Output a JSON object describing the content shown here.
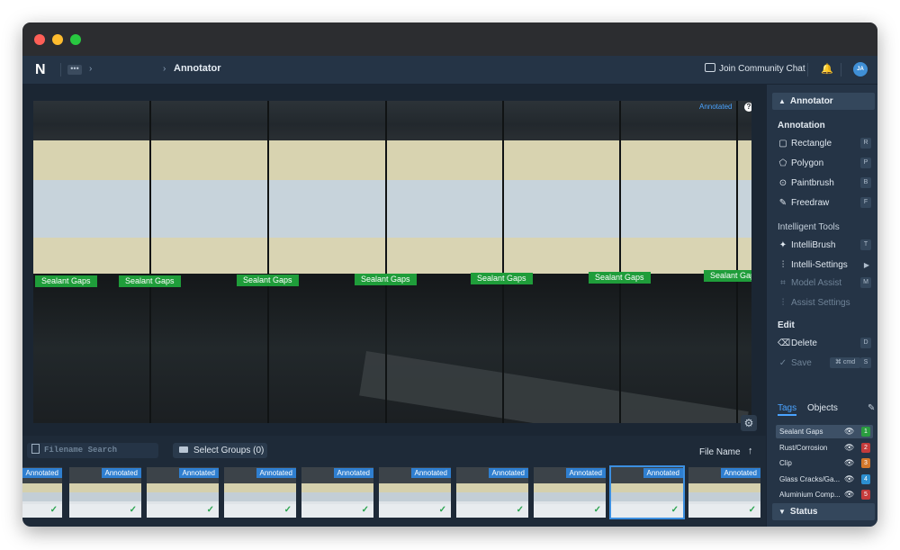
{
  "app": {
    "logo_letter": "N",
    "breadcrumb_ellipsis": "•••",
    "breadcrumb_sep": "›",
    "page_title": "Annotator",
    "community_label": "Join Community Chat",
    "avatar_initials": "JA"
  },
  "canvas": {
    "annotated_badge": "Annotated",
    "help_glyph": "?",
    "labels": [
      "Sealant Gaps",
      "Sealant Gaps",
      "Sealant Gaps",
      "Sealant Gaps",
      "Sealant Gaps",
      "Sealant Gaps",
      "Sealant Gap"
    ]
  },
  "filebar": {
    "search_placeholder": "Filename Search",
    "select_groups": "Select Groups (0)",
    "sort_label": "File Name",
    "sort_arrow": "↑"
  },
  "thumbnails": {
    "badge": "Annotated",
    "check": "✓",
    "count": 10,
    "selected_index": 8
  },
  "sidebar": {
    "panel_title": "Annotator",
    "annotation_title": "Annotation",
    "tools": [
      {
        "label": "Rectangle",
        "key": "R",
        "icon": "rectangle-icon"
      },
      {
        "label": "Polygon",
        "key": "P",
        "icon": "polygon-icon"
      },
      {
        "label": "Paintbrush",
        "key": "B",
        "icon": "paintbrush-icon"
      },
      {
        "label": "Freedraw",
        "key": "F",
        "icon": "pencil-icon"
      }
    ],
    "intelligent_title": "Intelligent Tools",
    "intelli": [
      {
        "label": "IntelliBrush",
        "key": "T"
      },
      {
        "label": "Intelli-Settings"
      },
      {
        "label": "Model Assist",
        "key": "M"
      },
      {
        "label": "Assist Settings"
      }
    ],
    "edit_title": "Edit",
    "delete_label": "Delete",
    "delete_key": "D",
    "save_label": "Save",
    "save_cmd": "cmd",
    "save_key": "S",
    "tabs": {
      "tags": "Tags",
      "objects": "Objects"
    },
    "tags": [
      {
        "name": "Sealant Gaps",
        "hotkey": "1",
        "color": "#2a9d3f"
      },
      {
        "name": "Rust/Corrosion",
        "hotkey": "2",
        "color": "#c43b3b"
      },
      {
        "name": "Clip",
        "hotkey": "3",
        "color": "#d2772b"
      },
      {
        "name": "Glass Cracks/Ga...",
        "hotkey": "4",
        "color": "#2c8fd0"
      },
      {
        "name": "Aluminium Comp...",
        "hotkey": "5",
        "color": "#c43b3b"
      }
    ],
    "status_title": "Status"
  }
}
